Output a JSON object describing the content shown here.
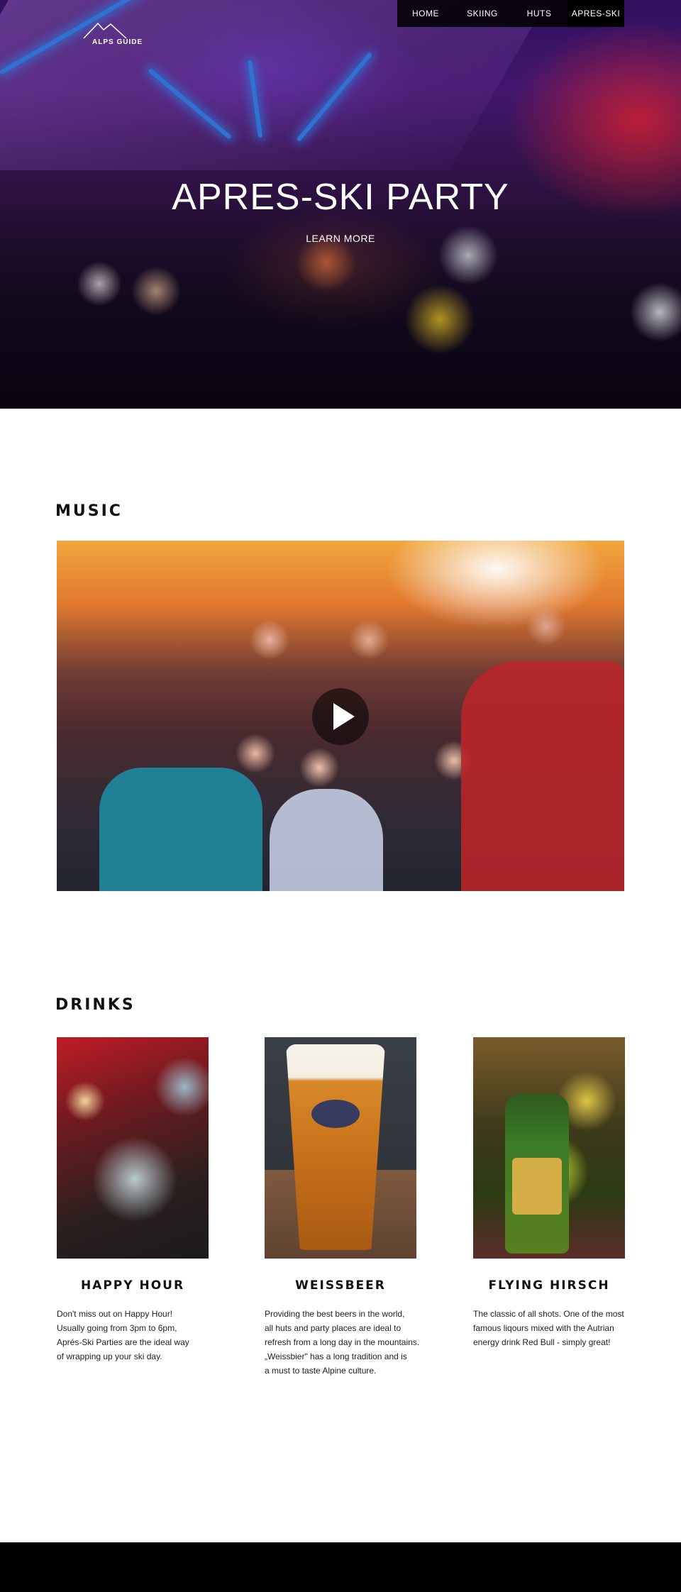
{
  "brand": {
    "logo_text": "ALPS GUIDE"
  },
  "nav": {
    "items": [
      {
        "label": "HOME"
      },
      {
        "label": "SKIING"
      },
      {
        "label": "HUTS"
      },
      {
        "label": "APRES-SKI"
      }
    ],
    "active": "APRES-SKI"
  },
  "hero": {
    "title": "APRES-SKI PARTY",
    "cta": "LEARN MORE"
  },
  "music": {
    "title": "MUSIC",
    "video_icon": "play-icon"
  },
  "drinks": {
    "title": "DRINKS",
    "items": [
      {
        "title": "HAPPY HOUR",
        "text": [
          "Don't miss out on Happy Hour!",
          "Usually going from 3pm to 6pm,",
          "Aprés-Ski Parties are the ideal way",
          "of wrapping up your ski day."
        ]
      },
      {
        "title": "WEISSBEER",
        "text": [
          "Providing the best beers in the world,",
          "all huts and party places are ideal to",
          "refresh from a long day in the mountains.",
          "„Weissbier\" has a long tradition and is",
          "a must to taste Alpine culture."
        ]
      },
      {
        "title": "FLYING HIRSCH",
        "text": [
          "The classic of all shots. One of the most",
          "famous liqours mixed with the Autrian",
          "energy drink Red Bull - simply great!"
        ]
      }
    ]
  },
  "colors": {
    "nav_bg": "#000000",
    "footer_bg": "#000000",
    "neon": "#3a8bff"
  }
}
